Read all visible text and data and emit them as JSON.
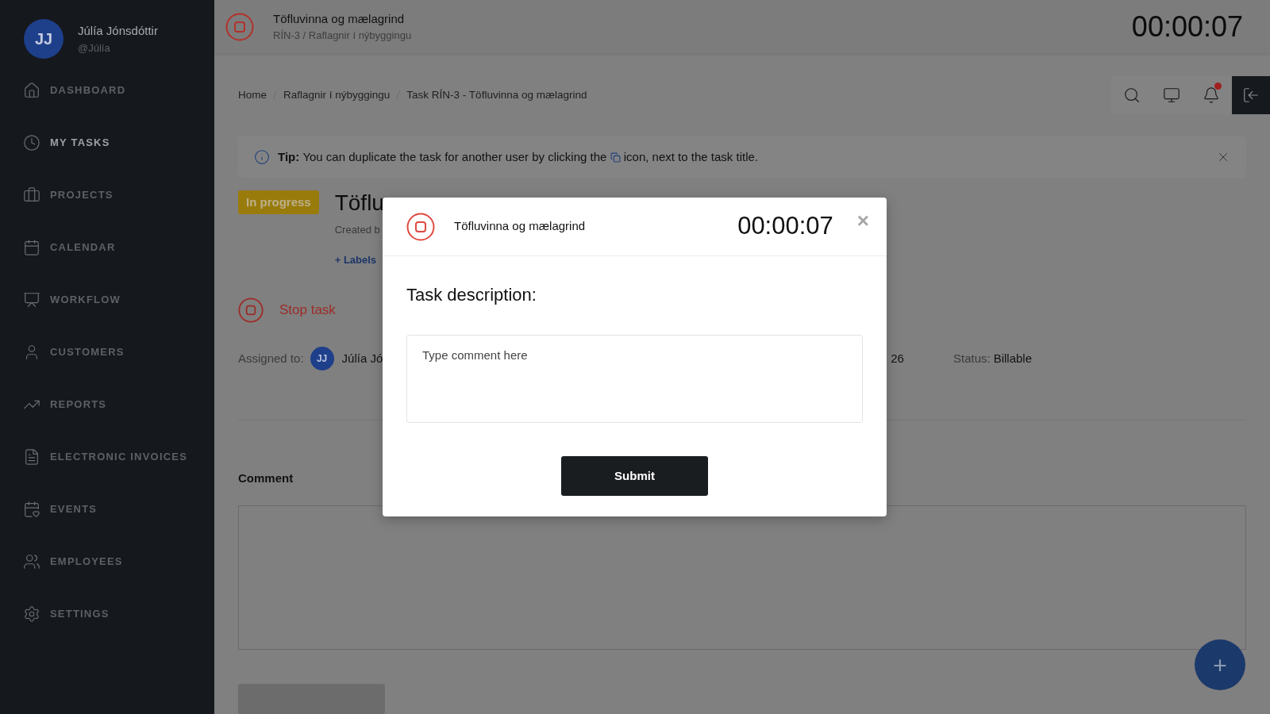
{
  "user": {
    "initials": "JJ",
    "name": "Júlía Jónsdóttir",
    "handle": "@Júlía"
  },
  "nav": [
    {
      "label": "DASHBOARD",
      "selected": false
    },
    {
      "label": "MY TASKS",
      "selected": true
    },
    {
      "label": "PROJECTS",
      "selected": false
    },
    {
      "label": "CALENDAR",
      "selected": false
    },
    {
      "label": "WORKFLOW",
      "selected": false
    },
    {
      "label": "CUSTOMERS",
      "selected": false
    },
    {
      "label": "REPORTS",
      "selected": false
    },
    {
      "label": "ELECTRONIC INVOICES",
      "selected": false
    },
    {
      "label": "EVENTS",
      "selected": false
    },
    {
      "label": "EMPLOYEES",
      "selected": false
    },
    {
      "label": "SETTINGS",
      "selected": false
    }
  ],
  "timer_bar": {
    "title": "Töfluvinna og mælagrind",
    "subtitle": "RÍN-3 / Raflagnir í nýbyggingu",
    "time": "00:00:07"
  },
  "breadcrumb": [
    "Home",
    "Raflagnir í nýbyggingu",
    "Task RÍN-3 - Töfluvinna og mælagrind"
  ],
  "toolbar": {
    "notification_dot": true
  },
  "tip": {
    "label": "Tip:",
    "before": "You can duplicate the task for another user by clicking the",
    "after": "icon, next to the task title."
  },
  "task": {
    "status": "In progress",
    "title": "Töflu",
    "created": "Created b",
    "labels_link": "+ Labels",
    "stop_label": "Stop task",
    "assigned_label": "Assigned to:",
    "assignee_initials": "JJ",
    "assignee_name": "Júlía Jó",
    "date_fragment": "26",
    "status_label": "Status:",
    "status_value": "Billable"
  },
  "comment": {
    "label": "Comment"
  },
  "modal": {
    "title": "Töfluvinna og mælagrind",
    "time": "00:00:07",
    "close": "×",
    "heading": "Task description:",
    "placeholder": "Type comment here",
    "submit": "Submit"
  },
  "fab": "+"
}
